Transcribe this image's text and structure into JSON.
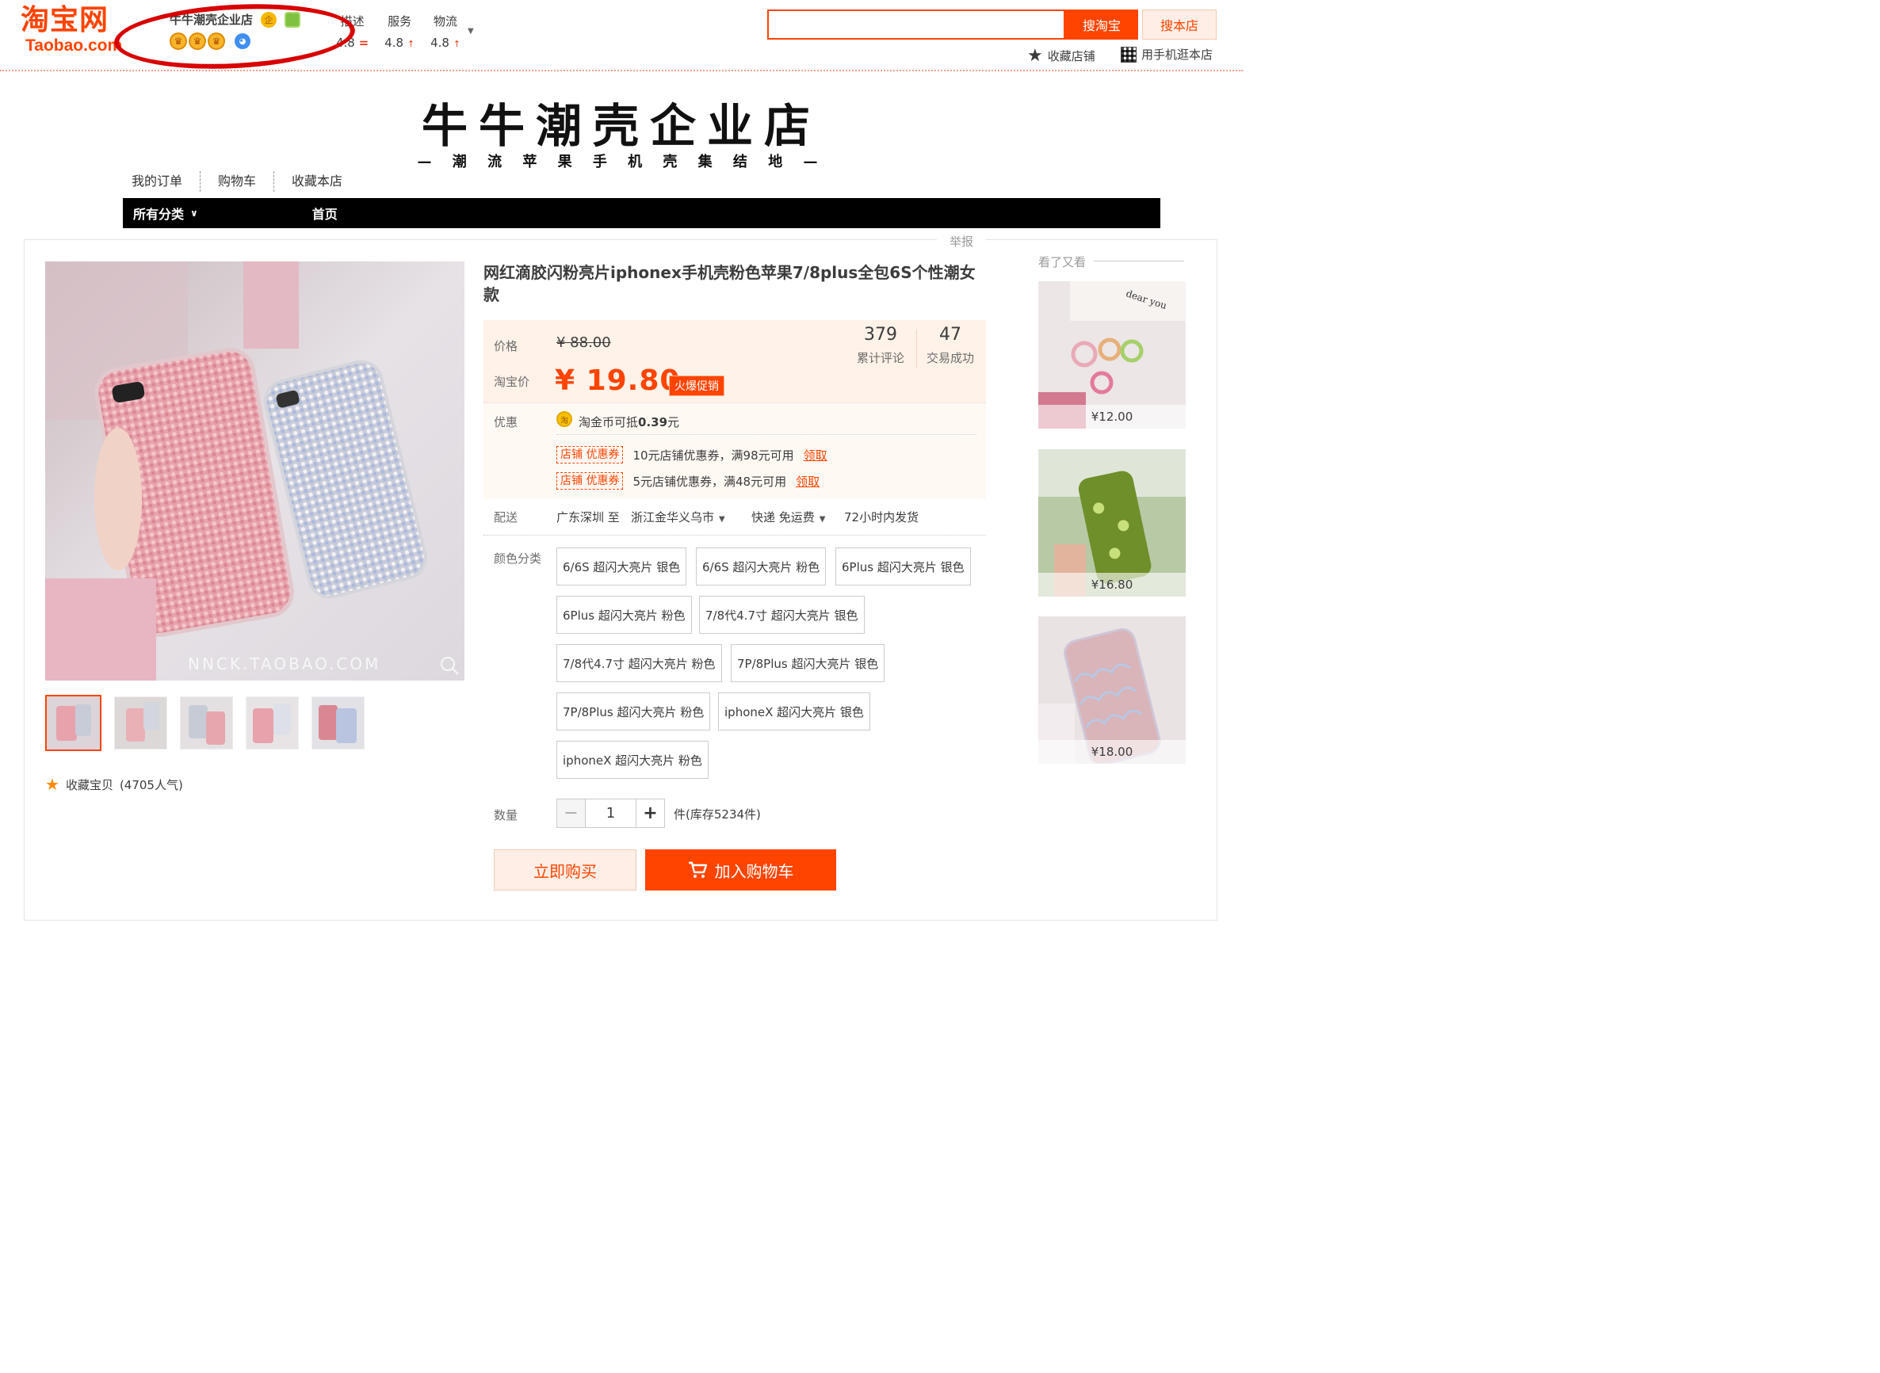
{
  "header": {
    "logo_cn": "淘宝网",
    "logo_en": "Taobao.com",
    "shop_name": "牛牛潮壳企业店",
    "ratings": [
      {
        "label": "描述",
        "value": "4.8",
        "trend": "="
      },
      {
        "label": "服务",
        "value": "4.8",
        "trend": "↑"
      },
      {
        "label": "物流",
        "value": "4.8",
        "trend": "↑"
      }
    ],
    "search_placeholder": "",
    "search_taobao": "搜淘宝",
    "search_shop": "搜本店",
    "favorite_shop": "收藏店铺",
    "mobile_shop": "用手机逛本店"
  },
  "shop": {
    "banner_title": "牛牛潮壳企业店",
    "banner_subtitle": "— 潮 流 苹 果 手 机 壳 集 结 地 —",
    "links": [
      "我的订单",
      "购物车",
      "收藏本店"
    ],
    "nav": {
      "all_categories": "所有分类",
      "home": "首页"
    }
  },
  "product": {
    "report": "举报",
    "title": "网红滴胶闪粉亮片iphonex手机壳粉色苹果7/8plus全包6S个性潮女款",
    "watermark": "NNCK.TAOBAO.COM",
    "price_label": "价格",
    "old_price": "¥ 88.00",
    "tb_price_label": "淘宝价",
    "new_price": "¥ 19.80",
    "hot_tag": "火爆促销",
    "reviews": {
      "count": "379",
      "label": "累计评论"
    },
    "deals": {
      "count": "47",
      "label": "交易成功"
    },
    "promo_label": "优惠",
    "coin_icon": "淘",
    "coin_text_prefix": "淘金币可抵",
    "coin_amount": "0.39",
    "coin_text_suffix": "元",
    "coupons": [
      {
        "tag": "店铺 优惠券",
        "text": "10元店铺优惠券，满98元可用",
        "action": "领取"
      },
      {
        "tag": "店铺 优惠券",
        "text": "5元店铺优惠券，满48元可用",
        "action": "领取"
      }
    ],
    "delivery_label": "配送",
    "delivery_from": "广东深圳 至",
    "delivery_to": "浙江金华义乌市",
    "delivery_method": "快递 免运费",
    "delivery_time": "72小时内发货",
    "color_label": "颜色分类",
    "skus": [
      "6/6S 超闪大亮片 银色",
      "6/6S 超闪大亮片 粉色",
      "6Plus 超闪大亮片 银色",
      "6Plus 超闪大亮片 粉色",
      "7/8代4.7寸 超闪大亮片 银色",
      "7/8代4.7寸 超闪大亮片 粉色",
      "7P/8Plus 超闪大亮片 银色",
      "7P/8Plus 超闪大亮片 粉色",
      "iphoneX 超闪大亮片 银色",
      "iphoneX 超闪大亮片 粉色"
    ],
    "qty_label": "数量",
    "qty_value": "1",
    "stock": "件(库存5234件)",
    "buy_now": "立即购买",
    "add_cart": "加入购物车",
    "favorite": "收藏宝贝",
    "favorite_count": "(4705人气)"
  },
  "see_again": {
    "title": "看了又看",
    "items": [
      {
        "price": "¥12.00",
        "overlay": "dear you"
      },
      {
        "price": "¥16.80"
      },
      {
        "price": "¥18.00"
      }
    ]
  },
  "colors": {
    "accent": "#ff4400",
    "annotation": "#d80000"
  }
}
